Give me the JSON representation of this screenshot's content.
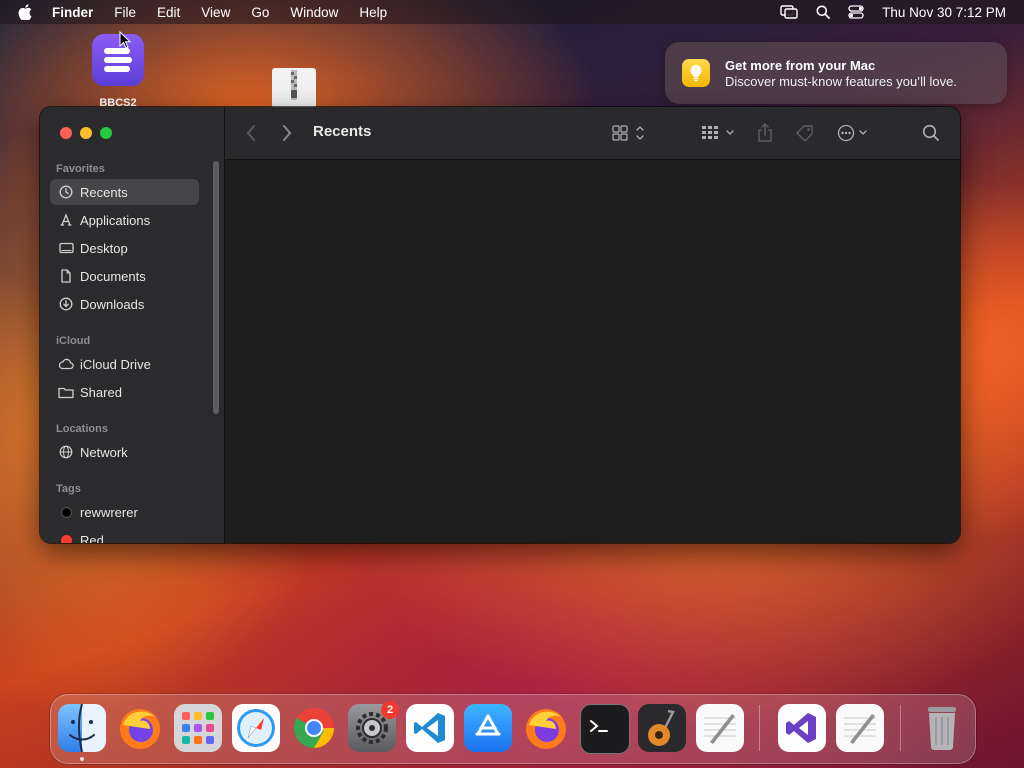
{
  "menubar": {
    "app_name": "Finder",
    "items": [
      "File",
      "Edit",
      "View",
      "Go",
      "Window",
      "Help"
    ],
    "clock": "Thu Nov 30  7:12 PM"
  },
  "desktop": {
    "icons": [
      {
        "label": "BBCS2",
        "icon": "bbedit-app-icon"
      },
      {
        "label": "",
        "icon": "zip-archive-icon"
      }
    ]
  },
  "notification": {
    "title": "Get more from your Mac",
    "body": "Discover must-know features you’ll love.",
    "icon": "lightbulb-icon"
  },
  "finder": {
    "title": "Recents",
    "sidebar": {
      "favorites_header": "Favorites",
      "favorites": [
        {
          "label": "Recents",
          "icon": "clock-icon",
          "selected": true
        },
        {
          "label": "Applications",
          "icon": "applications-icon",
          "selected": false
        },
        {
          "label": "Desktop",
          "icon": "desktop-icon",
          "selected": false
        },
        {
          "label": "Documents",
          "icon": "document-icon",
          "selected": false
        },
        {
          "label": "Downloads",
          "icon": "download-icon",
          "selected": false
        }
      ],
      "icloud_header": "iCloud",
      "icloud": [
        {
          "label": "iCloud Drive",
          "icon": "cloud-icon"
        },
        {
          "label": "Shared",
          "icon": "shared-folder-icon"
        }
      ],
      "locations_header": "Locations",
      "locations": [
        {
          "label": "Network",
          "icon": "network-icon"
        }
      ],
      "tags_header": "Tags",
      "tags": [
        {
          "label": "rewwrerer",
          "color": "#000000"
        },
        {
          "label": "Red",
          "color": "#ff3b30"
        }
      ]
    }
  },
  "dock": {
    "apps": [
      {
        "name": "Finder",
        "icon": "finder-icon",
        "running": true
      },
      {
        "name": "Firefox",
        "icon": "firefox-icon"
      },
      {
        "name": "Launchpad",
        "icon": "launchpad-icon"
      },
      {
        "name": "Safari",
        "icon": "safari-icon"
      },
      {
        "name": "Chrome",
        "icon": "chrome-icon"
      },
      {
        "name": "System Settings",
        "icon": "settings-icon",
        "badge": "2"
      },
      {
        "name": "VS Code",
        "icon": "vscode-icon"
      },
      {
        "name": "App Store",
        "icon": "app-store-icon"
      },
      {
        "name": "Firefox Developer",
        "icon": "firefox-dev-icon"
      },
      {
        "name": "Terminal",
        "icon": "terminal-icon"
      },
      {
        "name": "GarageBand",
        "icon": "garageband-icon"
      },
      {
        "name": "TextEdit",
        "icon": "textedit-icon"
      },
      {
        "name": "Visual Studio",
        "icon": "visual-studio-icon"
      },
      {
        "name": "TextEdit Document",
        "icon": "textedit-doc-icon"
      },
      {
        "name": "Trash",
        "icon": "trash-icon"
      }
    ]
  },
  "colors": {
    "sidebar_bg": "#2b2b2d",
    "content_bg": "#1e1e1e",
    "selection": "#464649",
    "close": "#ff5f57",
    "minimize": "#febc2e",
    "zoom": "#28c840",
    "badge": "#f03a2e"
  }
}
